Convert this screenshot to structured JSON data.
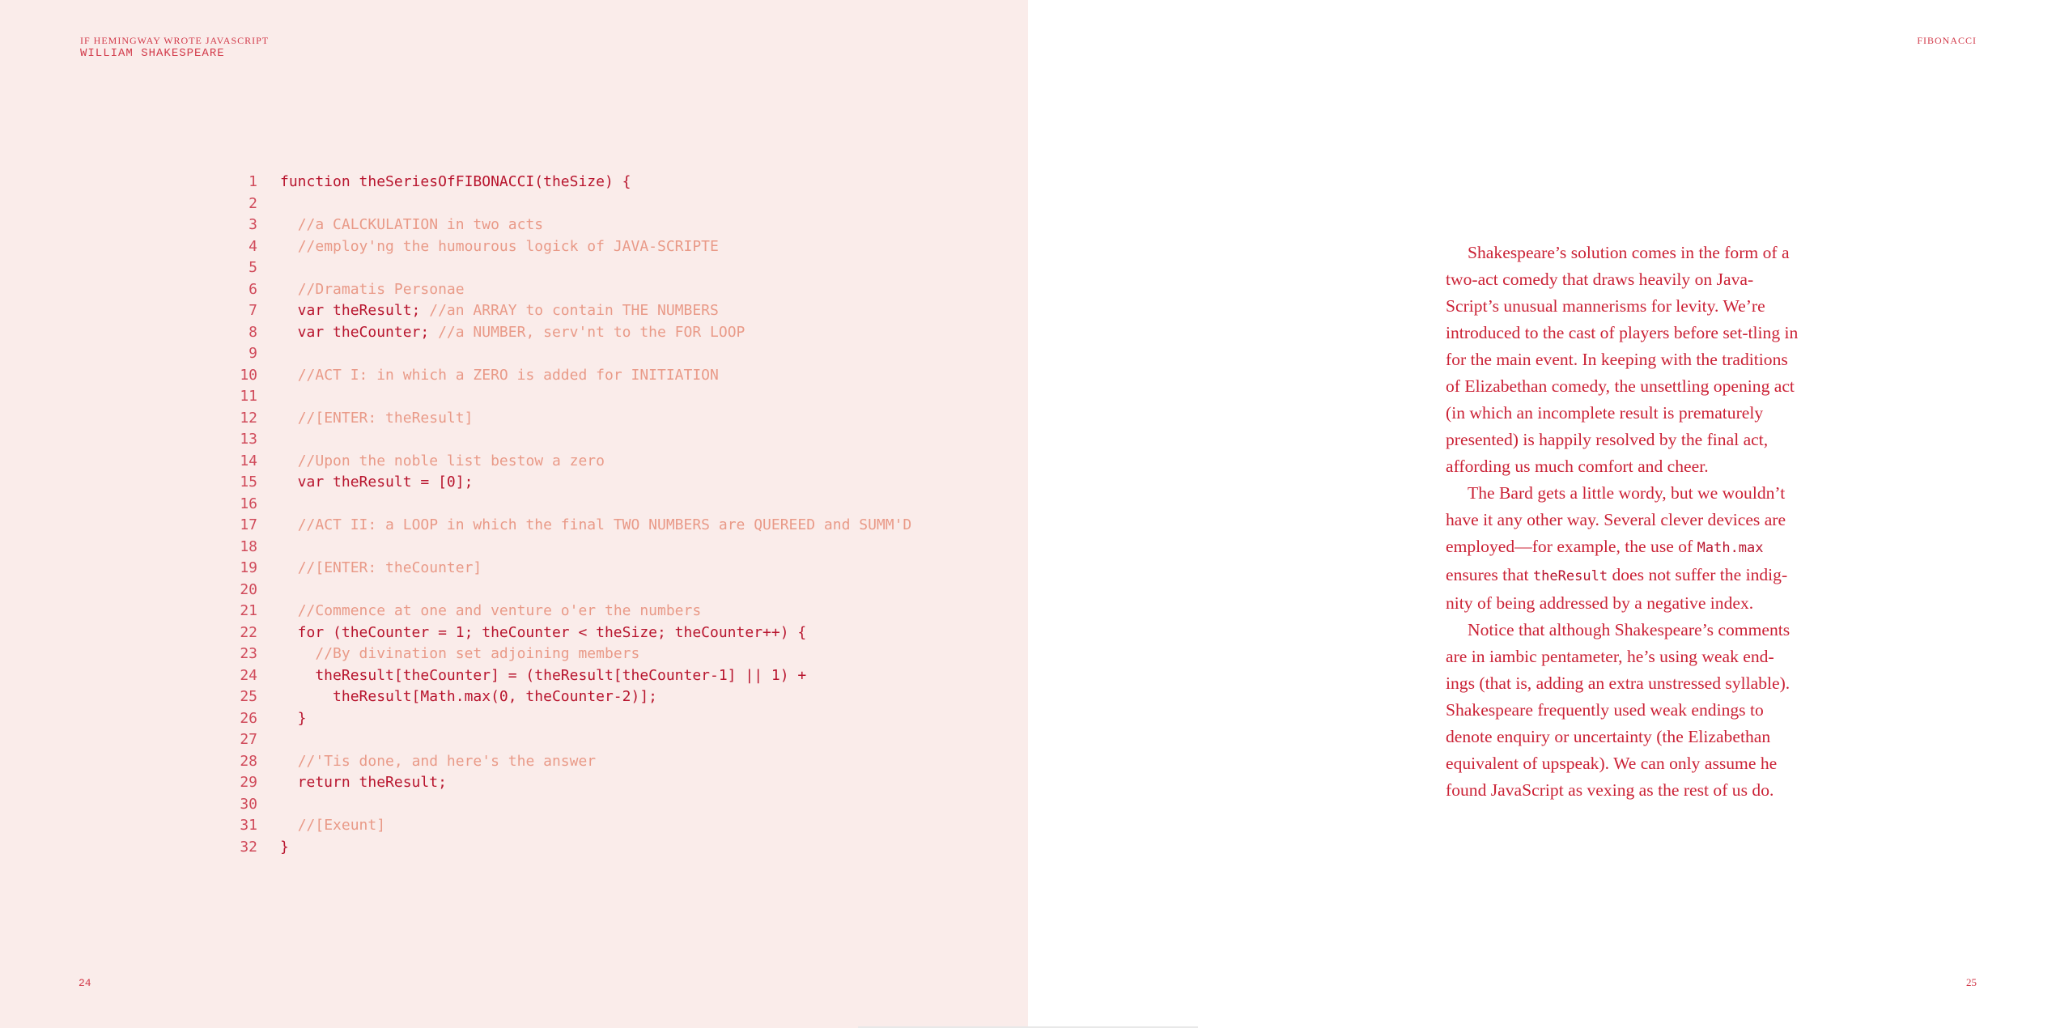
{
  "left_page": {
    "book_title": "IF HEMINGWAY WROTE JAVASCRIPT",
    "author": "WILLIAM SHAKESPEARE",
    "page_number": "24"
  },
  "right_page": {
    "section": "FIBONACCI",
    "page_number": "25"
  },
  "code_lines": [
    {
      "n": "1",
      "code": "function theSeriesOfFIBONACCI(theSize) {",
      "comment": ""
    },
    {
      "n": "2",
      "code": "",
      "comment": ""
    },
    {
      "n": "3",
      "code": "  ",
      "comment": "//a CALCKULATION in two acts"
    },
    {
      "n": "4",
      "code": "  ",
      "comment": "//employ'ng the humourous logick of JAVA-SCRIPTE"
    },
    {
      "n": "5",
      "code": "",
      "comment": ""
    },
    {
      "n": "6",
      "code": "  ",
      "comment": "//Dramatis Personae"
    },
    {
      "n": "7",
      "code": "  var theResult; ",
      "comment": "//an ARRAY to contain THE NUMBERS"
    },
    {
      "n": "8",
      "code": "  var theCounter; ",
      "comment": "//a NUMBER, serv'nt to the FOR LOOP"
    },
    {
      "n": "9",
      "code": "",
      "comment": ""
    },
    {
      "n": "10",
      "code": "  ",
      "comment": "//ACT I: in which a ZERO is added for INITIATION"
    },
    {
      "n": "11",
      "code": "",
      "comment": ""
    },
    {
      "n": "12",
      "code": "  ",
      "comment": "//[ENTER: theResult]"
    },
    {
      "n": "13",
      "code": "",
      "comment": ""
    },
    {
      "n": "14",
      "code": "  ",
      "comment": "//Upon the noble list bestow a zero"
    },
    {
      "n": "15",
      "code": "  var theResult = [0];",
      "comment": ""
    },
    {
      "n": "16",
      "code": "",
      "comment": ""
    },
    {
      "n": "17",
      "code": "  ",
      "comment": "//ACT II: a LOOP in which the final TWO NUMBERS are QUEREED and SUMM'D"
    },
    {
      "n": "18",
      "code": "",
      "comment": ""
    },
    {
      "n": "19",
      "code": "  ",
      "comment": "//[ENTER: theCounter]"
    },
    {
      "n": "20",
      "code": "",
      "comment": ""
    },
    {
      "n": "21",
      "code": "  ",
      "comment": "//Commence at one and venture o'er the numbers"
    },
    {
      "n": "22",
      "code": "  for (theCounter = 1; theCounter < theSize; theCounter++) {",
      "comment": ""
    },
    {
      "n": "23",
      "code": "    ",
      "comment": "//By divination set adjoining members"
    },
    {
      "n": "24",
      "code": "    theResult[theCounter] = (theResult[theCounter-1] || 1) +",
      "comment": ""
    },
    {
      "n": "25",
      "code": "      theResult[Math.max(0, theCounter-2)];",
      "comment": ""
    },
    {
      "n": "26",
      "code": "  }",
      "comment": ""
    },
    {
      "n": "27",
      "code": "",
      "comment": ""
    },
    {
      "n": "28",
      "code": "  ",
      "comment": "//'Tis done, and here's the answer"
    },
    {
      "n": "29",
      "code": "  return theResult;",
      "comment": ""
    },
    {
      "n": "30",
      "code": "",
      "comment": ""
    },
    {
      "n": "31",
      "code": "  ",
      "comment": "//[Exeunt]"
    },
    {
      "n": "32",
      "code": "}",
      "comment": ""
    }
  ],
  "prose": {
    "p1": "Shakespeare’s solution comes in the form of a two-act comedy that draws heavily on Java-Script’s unusual mannerisms for levity. We’re introduced to the cast of players before set-tling in for the main event. In keeping with the traditions of Elizabethan comedy, the unsettling opening act (in which an incomplete result is prematurely presented) is happily resolved by the final act, affording us much comfort and cheer.",
    "p2_a": "The Bard gets a little wordy, but we wouldn’t have it any other way. Several clever devices are employed—for example, the use of ",
    "p2_code1": "Math.max",
    "p2_b": " ensures that ",
    "p2_code2": "theResult",
    "p2_c": " does not suffer the indig-nity of being addressed by a negative index.",
    "p3": "Notice that although Shakespeare’s comments are in iambic pentameter, he’s using weak end-ings (that is, adding an extra unstressed syllable). Shakespeare frequently used weak endings to denote enquiry or uncertainty (the Elizabethan equivalent of upspeak). We can only assume he found JavaScript as vexing as the rest of us do."
  },
  "colors": {
    "left_page_bg": "#faecea",
    "right_page_bg": "#ffffff",
    "accent": "#cb2236",
    "code_comment": "#e99a88"
  }
}
